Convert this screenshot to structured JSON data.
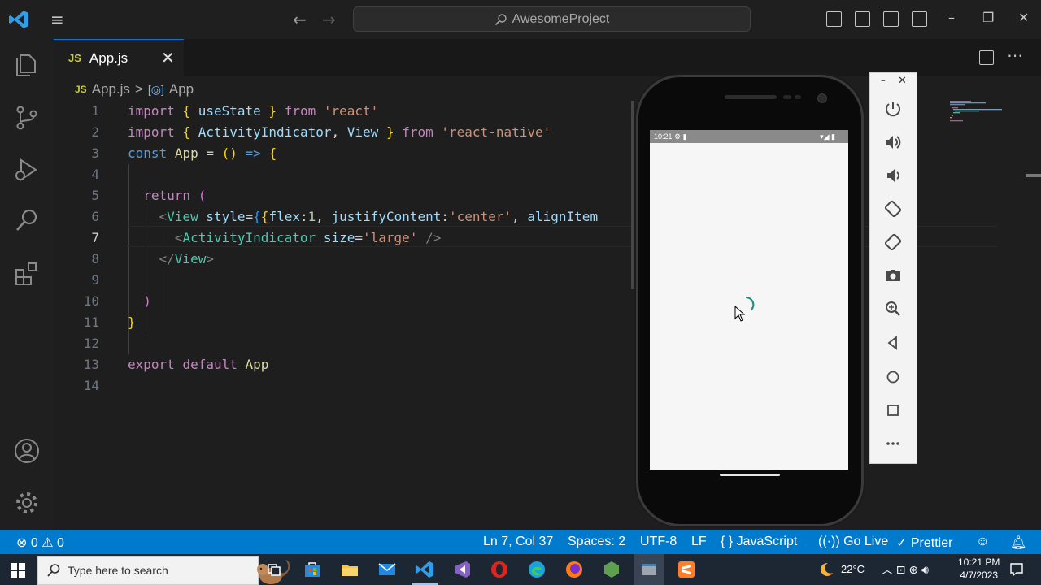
{
  "titlebar": {
    "search_text": "AwesomeProject",
    "icons": [
      "vscode-logo-icon",
      "menu-icon",
      "back-arrow-icon",
      "forward-arrow-icon",
      "search-icon",
      "toggle-sidebar-icon",
      "toggle-panel-icon",
      "toggle-secondary-sidebar-icon",
      "customize-layout-icon",
      "minimize-icon",
      "restore-icon",
      "close-icon"
    ]
  },
  "activitybar": {
    "items": [
      "explorer-icon",
      "source-control-icon",
      "run-debug-icon",
      "search-icon",
      "extensions-icon"
    ],
    "bottom": [
      "accounts-icon",
      "manage-gear-icon"
    ]
  },
  "tab": {
    "lang": "JS",
    "name": "App.js",
    "close": "✕"
  },
  "breadcrumb": {
    "lang": "JS",
    "file": "App.js",
    "separator": ">",
    "symbol_icon": "[◎]",
    "symbol": "App"
  },
  "editor": {
    "active_line": 7,
    "lines": [
      {
        "n": "1",
        "text": "import { useState } from 'react'"
      },
      {
        "n": "2",
        "text": "import { ActivityIndicator, View } from 'react-native'"
      },
      {
        "n": "3",
        "text": "const App = () => {"
      },
      {
        "n": "4",
        "text": ""
      },
      {
        "n": "5",
        "text": "  return ("
      },
      {
        "n": "6",
        "text": "    <View style={{flex:1, justifyContent:'center', alignItem"
      },
      {
        "n": "7",
        "text": "      <ActivityIndicator size='large' />"
      },
      {
        "n": "8",
        "text": "    </View>"
      },
      {
        "n": "9",
        "text": ""
      },
      {
        "n": "10",
        "text": "  )"
      },
      {
        "n": "11",
        "text": "}"
      },
      {
        "n": "12",
        "text": ""
      },
      {
        "n": "13",
        "text": "export default App"
      },
      {
        "n": "14",
        "text": ""
      }
    ]
  },
  "emulator": {
    "status_time": "10:21",
    "panel_buttons": [
      "power-icon",
      "volume-up-icon",
      "volume-down-icon",
      "rotate-left-icon",
      "rotate-right-icon",
      "camera-icon",
      "zoom-icon",
      "back-icon",
      "home-icon",
      "overview-icon",
      "more-icon"
    ],
    "minimize": "–",
    "close": "✕"
  },
  "statusbar": {
    "errors": "0",
    "warnings": "0",
    "cursor": "Ln 7, Col 37",
    "spaces": "Spaces: 2",
    "encoding": "UTF-8",
    "eol": "LF",
    "language": "JavaScript",
    "golive": "Go Live",
    "prettier": "Prettier",
    "lang_icon": "{ }"
  },
  "taskbar": {
    "search_placeholder": "Type here to search",
    "temperature": "22°C",
    "time": "10:21 PM",
    "date": "4/7/2023",
    "apps": [
      "task-view-icon",
      "store-icon",
      "file-explorer-icon",
      "mail-icon",
      "vscode-icon",
      "vs-icon",
      "opera-icon",
      "edge-icon",
      "firefox-icon",
      "node-icon",
      "emulator-icon",
      "sublime-icon"
    ]
  },
  "colors": {
    "accent": "#007acc",
    "editor_bg": "#1e1e1e",
    "sidebar_bg": "#1f1f1f"
  }
}
